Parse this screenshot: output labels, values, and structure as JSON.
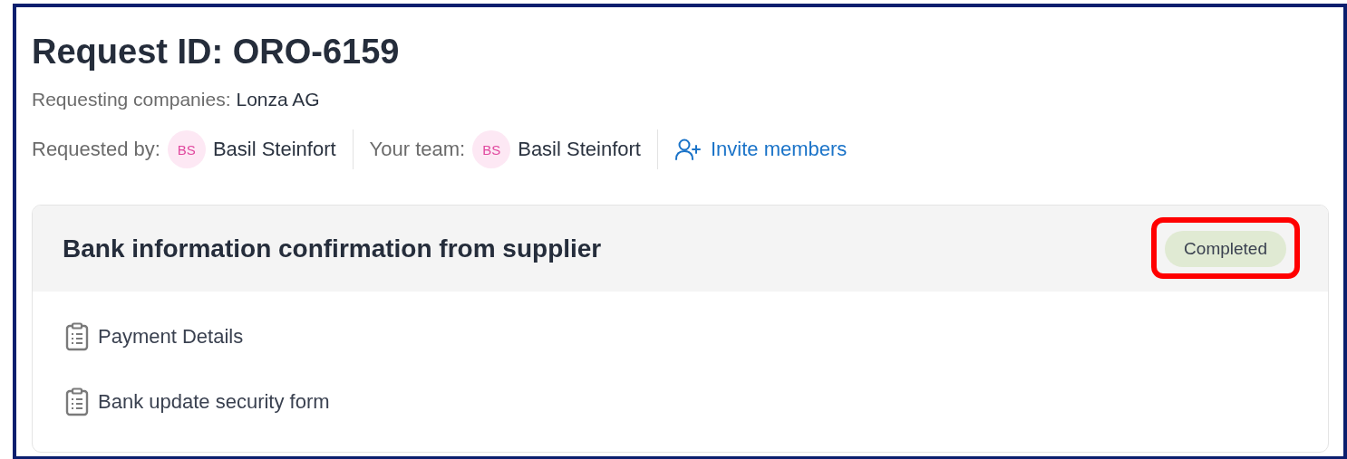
{
  "title": "Request ID: ORO-6159",
  "requesting_companies": {
    "label": "Requesting companies:",
    "value": "Lonza AG"
  },
  "people": [
    {
      "label": "Requested by:",
      "initials": "BS",
      "name": "Basil Steinfort"
    },
    {
      "label": "Your team:",
      "initials": "BS",
      "name": "Basil Steinfort"
    }
  ],
  "invite_link": "Invite members",
  "task": {
    "title": "Bank information confirmation from supplier",
    "status": "Completed",
    "status_highlighted": true,
    "items": [
      "Payment Details",
      "Bank update security form"
    ]
  }
}
